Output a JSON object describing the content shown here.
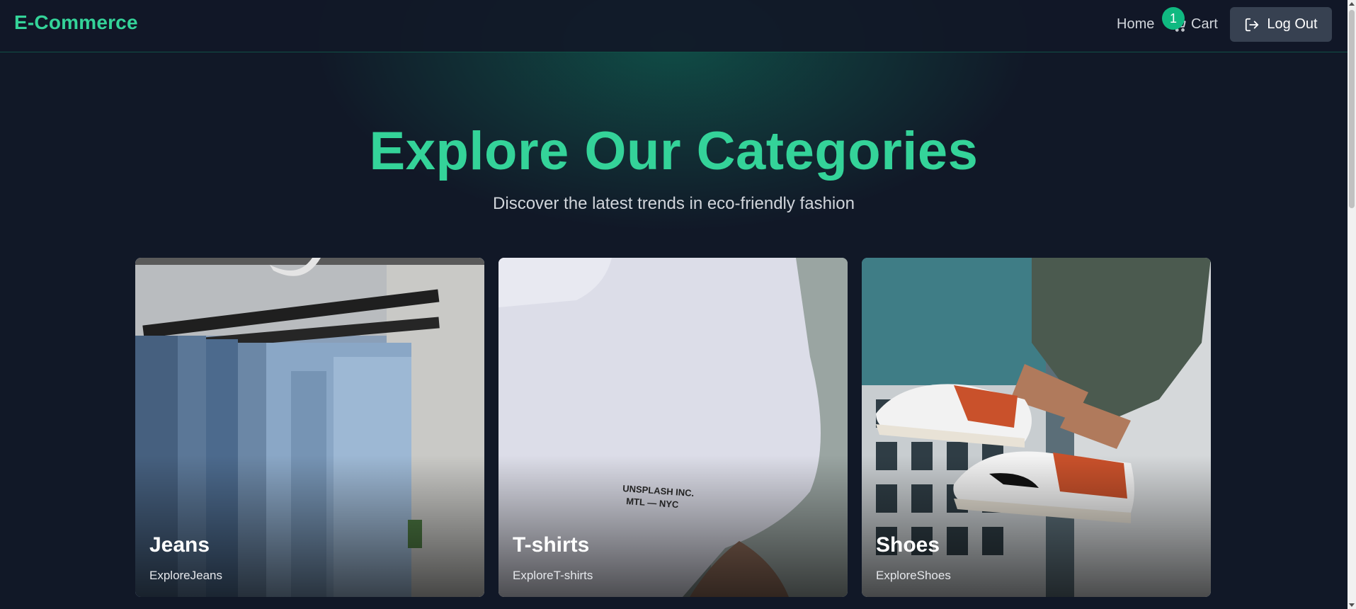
{
  "navbar": {
    "brand": "E-Commerce",
    "home_label": "Home",
    "cart_label": "Cart",
    "cart_count": "1",
    "logout_label": "Log Out"
  },
  "hero": {
    "title": "Explore Our Categories",
    "subtitle": "Discover the latest trends in eco-friendly fashion"
  },
  "categories": [
    {
      "name": "Jeans",
      "link_text": "ExploreJeans"
    },
    {
      "name": "T-shirts",
      "link_text": "ExploreT-shirts",
      "shirt_print": "UNSPLASH INC.\nMTL — NYC"
    },
    {
      "name": "Shoes",
      "link_text": "ExploreShoes"
    }
  ],
  "colors": {
    "accent": "#34d399",
    "badge": "#10b981",
    "background": "#111827",
    "logout_button": "#374151"
  },
  "icons": {
    "cart": "shopping-cart-icon",
    "logout": "log-out-icon"
  }
}
